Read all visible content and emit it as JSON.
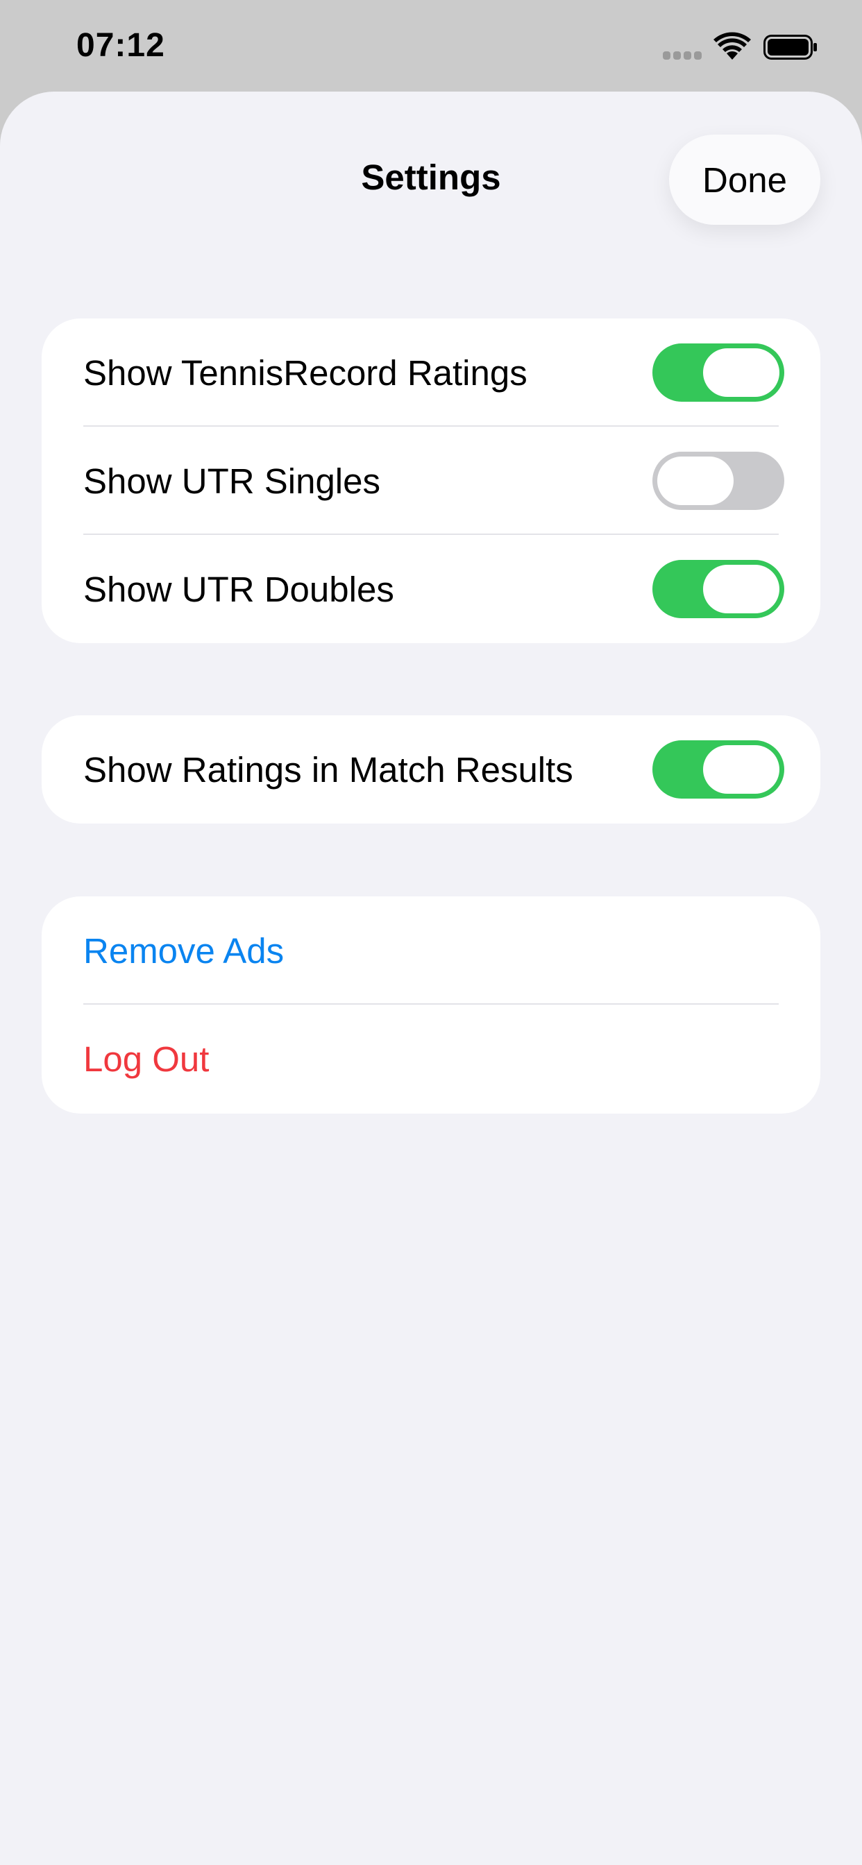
{
  "status_bar": {
    "time": "07:12"
  },
  "sheet": {
    "title": "Settings",
    "done_label": "Done"
  },
  "ratings_group": {
    "items": [
      {
        "label": "Show TennisRecord Ratings",
        "enabled": true
      },
      {
        "label": "Show UTR Singles",
        "enabled": false
      },
      {
        "label": "Show UTR Doubles",
        "enabled": true
      }
    ]
  },
  "match_group": {
    "items": [
      {
        "label": "Show Ratings in Match Results",
        "enabled": true
      }
    ]
  },
  "account_group": {
    "remove_ads_label": "Remove Ads",
    "log_out_label": "Log Out"
  },
  "colors": {
    "toggle_on": "#34c759",
    "toggle_off": "#c9c9cc",
    "link_blue": "#0a84f0",
    "destructive_red": "#f0383e",
    "sheet_background": "#f2f2f7"
  }
}
